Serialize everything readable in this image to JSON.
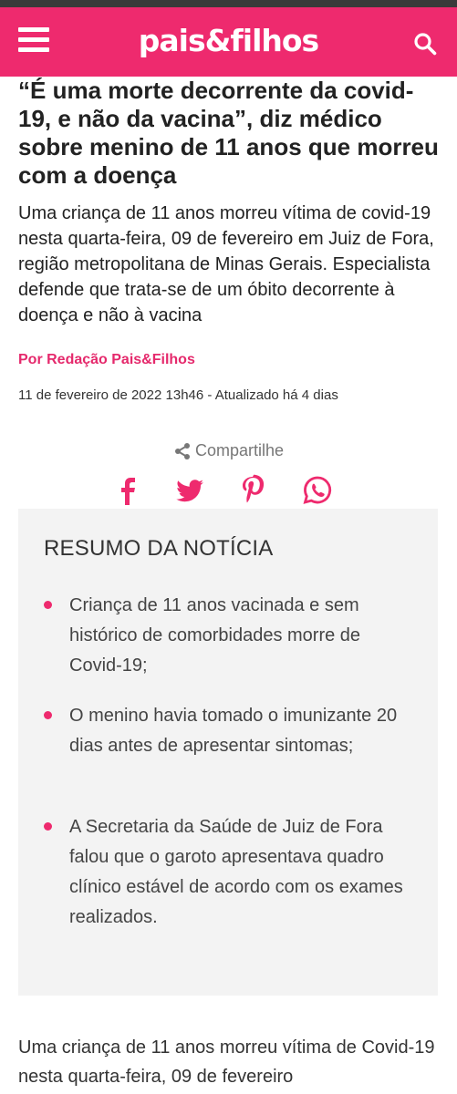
{
  "header": {
    "logo": "pais&filhos",
    "menu_icon": "hamburger-menu-icon",
    "search_icon": "search-icon",
    "brand_color": "#ee2a6e"
  },
  "article": {
    "title": "“É uma morte decorrente da covid-19, e não da vacina”, diz médico sobre menino de 11 anos que morreu com a doença",
    "subtitle": "Uma criança de 11 anos morreu vítima de covid-19 nesta quarta-feira, 09 de fevereiro em Juiz de Fora, região metropolitana de Minas Gerais. Especialista defende que trata-se de um óbito decorrente à doença e não à vacina",
    "author": "Por Redação Pais&Filhos",
    "date": "11 de fevereiro de 2022 13h46 - Atualizado há 4 dias"
  },
  "share": {
    "label": "Compartilhe",
    "networks": [
      "facebook",
      "twitter",
      "pinterest",
      "whatsapp"
    ]
  },
  "summary": {
    "title": "RESUMO DA NOTÍCIA",
    "items": [
      "Criança de 11 anos vacinada e sem histórico de comorbidades morre de Covid-19;",
      "O menino havia tomado o imunizante 20 dias antes de apresentar sintomas;",
      "A Secretaria da Saúde de Juiz de Fora falou que o garoto apresentava quadro clínico estável de acordo com os exames realizados."
    ]
  },
  "body": {
    "paragraph": "Uma criança de 11 anos morreu vítima de Covid-19 nesta quarta-feira, 09 de fevereiro"
  }
}
